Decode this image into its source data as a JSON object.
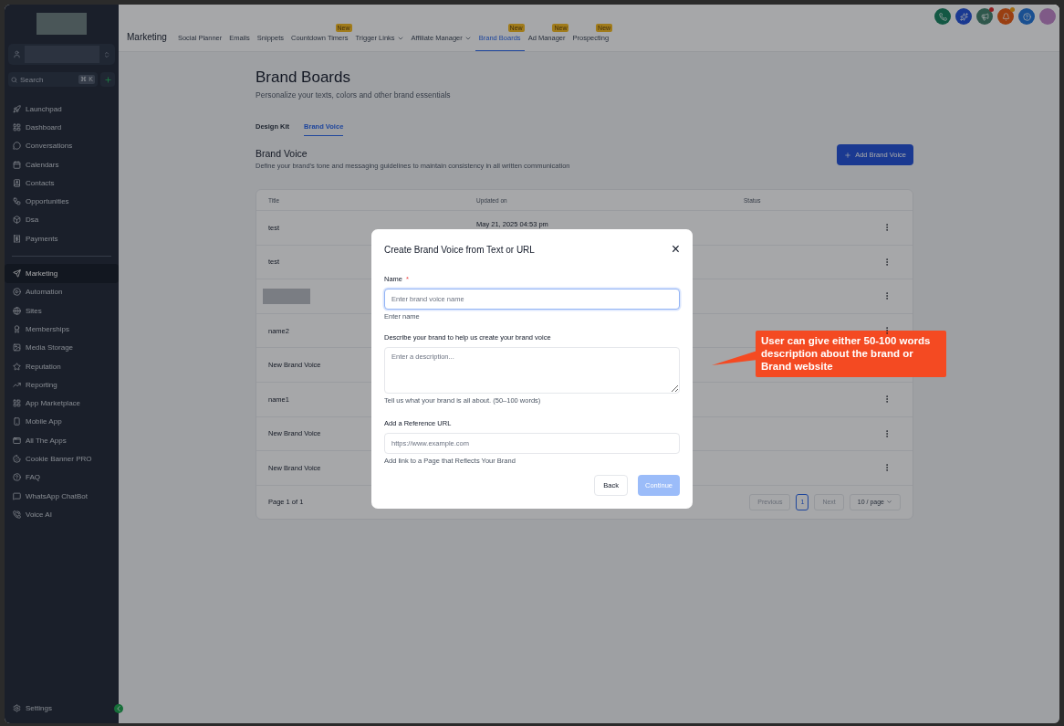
{
  "sidebar": {
    "search": {
      "placeholder": "Search",
      "shortcut": "⌘ K"
    },
    "items": [
      {
        "label": "Launchpad",
        "selected": false
      },
      {
        "label": "Dashboard",
        "selected": false
      },
      {
        "label": "Conversations",
        "selected": false
      },
      {
        "label": "Calendars",
        "selected": false
      },
      {
        "label": "Contacts",
        "selected": false
      },
      {
        "label": "Opportunities",
        "selected": false
      },
      {
        "label": "Dsa",
        "selected": false
      },
      {
        "label": "Payments",
        "selected": false
      }
    ],
    "items_2": [
      {
        "label": "Marketing",
        "selected": true
      },
      {
        "label": "Automation",
        "selected": false
      },
      {
        "label": "Sites",
        "selected": false
      },
      {
        "label": "Memberships",
        "selected": false
      },
      {
        "label": "Media Storage",
        "selected": false
      },
      {
        "label": "Reputation",
        "selected": false
      },
      {
        "label": "Reporting",
        "selected": false
      },
      {
        "label": "App Marketplace",
        "selected": false
      },
      {
        "label": "Mobile App",
        "selected": false
      },
      {
        "label": "All The Apps",
        "selected": false
      },
      {
        "label": "Cookie Banner PRO",
        "selected": false
      },
      {
        "label": "FAQ",
        "selected": false
      },
      {
        "label": "WhatsApp ChatBot",
        "selected": false
      },
      {
        "label": "Voice AI",
        "selected": false
      }
    ],
    "settings": "Settings"
  },
  "topnav": {
    "title": "Marketing",
    "tabs": [
      {
        "label": "Social Planner",
        "selected": false
      },
      {
        "label": "Emails",
        "selected": false
      },
      {
        "label": "Snippets",
        "selected": false
      },
      {
        "label": "Countdown Timers",
        "selected": false,
        "badge": "New"
      },
      {
        "label": "Trigger Links",
        "selected": false,
        "dropdown": true
      },
      {
        "label": "Affiliate Manager",
        "selected": false,
        "dropdown": true
      },
      {
        "label": "Brand Boards",
        "selected": true,
        "badge": "New"
      },
      {
        "label": "Ad Manager",
        "selected": false,
        "badge": "New"
      },
      {
        "label": "Prospecting",
        "selected": false,
        "badge": "New"
      }
    ],
    "notifications": [
      {
        "dot": false
      },
      {
        "dot": false
      },
      {
        "dot": true
      },
      {
        "dot": true
      },
      {
        "dot": false
      }
    ]
  },
  "page": {
    "title": "Brand Boards",
    "subtitle": "Personalize your texts, colors and other brand essentials",
    "tabs": [
      {
        "label": "Design Kit",
        "selected": false
      },
      {
        "label": "Brand Voice",
        "selected": true
      }
    ],
    "section_title": "Brand Voice",
    "section_subtitle": "Define your brand's tone and messaging guidelines to maintain consistency in all written communication",
    "add_button": "Add Brand Voice",
    "table": {
      "columns": [
        "Title",
        "Updated on",
        "Status"
      ],
      "rows": [
        {
          "title": "test",
          "updated": "May 21, 2025 04:53 pm",
          "menu": true
        },
        {
          "title": "test",
          "menu": true
        },
        {
          "title": "",
          "redacted": true,
          "menu": true
        },
        {
          "title": "name2",
          "menu": true
        },
        {
          "title": "New Brand Voice",
          "menu": false
        },
        {
          "title": "name1",
          "menu": true
        },
        {
          "title": "New Brand Voice",
          "menu": true
        },
        {
          "title": "New Brand Voice",
          "menu": true
        }
      ],
      "page_info": "Page 1 of 1",
      "pagination": {
        "previous": "Previous",
        "pages": [
          {
            "label": "1",
            "selected": true
          }
        ],
        "next": "Next",
        "per_page": "10 / page"
      }
    }
  },
  "modal": {
    "title": "Create Brand Voice from Text or URL",
    "close": "×",
    "name": {
      "label": "Name",
      "required": "*",
      "placeholder": "Enter brand voice name",
      "help": "Enter name"
    },
    "description": {
      "label": "Describe your brand to help us create your brand voice",
      "placeholder": "Enter a description...",
      "help": "Tell us what your brand is all about. (50–100 words)"
    },
    "url": {
      "label": "Add a Reference URL",
      "placeholder": "https://www.example.com",
      "help": "Add link to a Page that Reflects Your Brand"
    },
    "back": "Back",
    "continue": "Continue",
    "continue_disabled": true
  },
  "callout": "User can give either 50-100 words description about the brand or Brand website"
}
